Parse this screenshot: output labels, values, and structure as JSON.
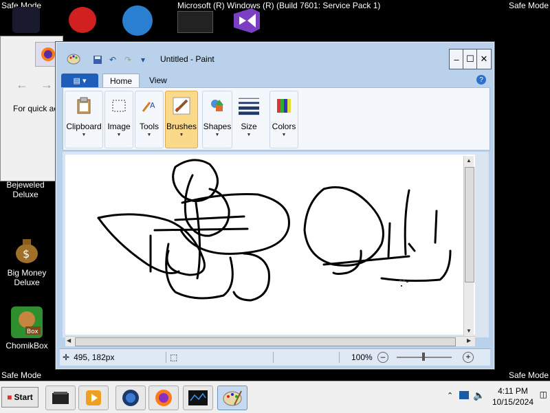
{
  "screen": {
    "safe_mode_label": "Safe Mode",
    "os_title": "Microsoft (R) Windows (R) (Build 7601: Service Pack 1)"
  },
  "desktop_icons": [
    {
      "label": "Bejeweled Deluxe"
    },
    {
      "label": "Big Money Deluxe"
    },
    {
      "label": "ChomikBox"
    }
  ],
  "bg_window": {
    "quick_access_text": "For quick ac"
  },
  "paint": {
    "title": "Untitled - Paint",
    "tabs": {
      "home": "Home",
      "view": "View"
    },
    "groups": [
      {
        "label": "Clipboard"
      },
      {
        "label": "Image"
      },
      {
        "label": "Tools"
      },
      {
        "label": "Brushes"
      },
      {
        "label": "Shapes"
      },
      {
        "label": "Size"
      },
      {
        "label": "Colors"
      }
    ],
    "status": {
      "cursor_pos": "495, 182px",
      "zoom": "100%"
    }
  },
  "taskbar": {
    "start_label": "Start",
    "time": "4:11 PM",
    "date": "10/15/2024"
  },
  "colors": {
    "desktop_bg": "#000000",
    "accent_blue": "#1e5db8",
    "selected_group": "#fbd98a"
  }
}
